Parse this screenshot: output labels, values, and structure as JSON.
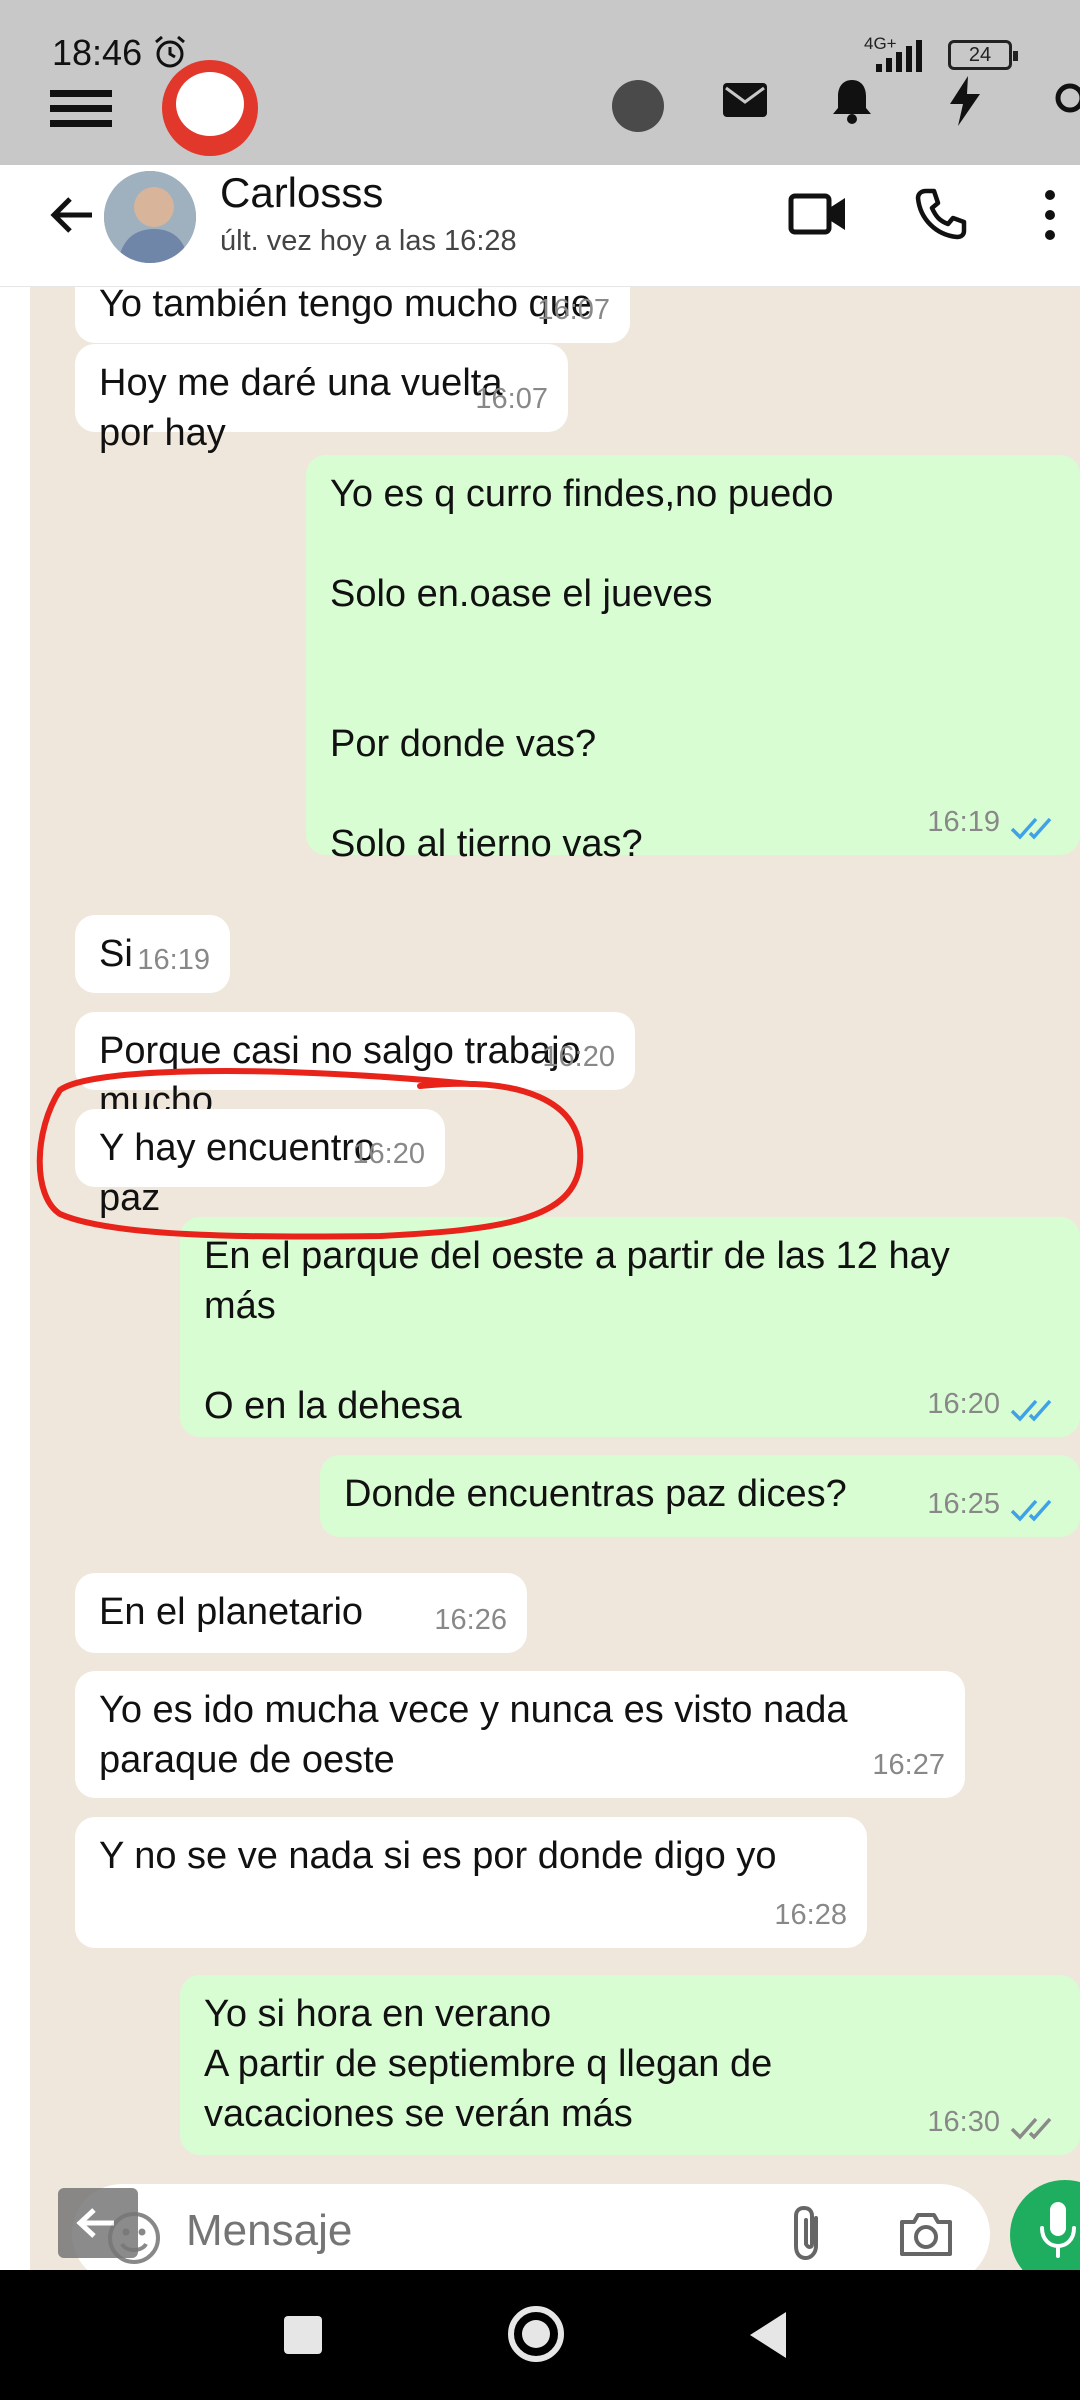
{
  "status_bar": {
    "time": "18:46",
    "network": "4G+",
    "battery": "24"
  },
  "chat_header": {
    "contact_name": "Carlosss",
    "last_seen": "últ. vez hoy a las 16:28"
  },
  "messages": [
    {
      "text": "Yo también tengo mucho que no voy",
      "time": "16:07"
    },
    {
      "text": "Hoy me daré una vuelta por hay",
      "time": "16:07"
    },
    {
      "text": "Yo es q curro findes,no puedo\n\nSolo en.oase el jueves\n\n\nPor donde vas?\n\nSolo al tierno vas?",
      "time": "16:19"
    },
    {
      "text": "Si",
      "time": "16:19"
    },
    {
      "text": "Porque casi no salgo trabajo mucho",
      "time": "16:20"
    },
    {
      "text": "Y hay encuentro paz",
      "time": "16:20"
    },
    {
      "text": "En el parque del oeste a partir de las 12 hay\nmás\n\nO en la dehesa",
      "time": "16:20"
    },
    {
      "text": "Donde encuentras paz dices?",
      "time": "16:25"
    },
    {
      "text": "En el planetario",
      "time": "16:26"
    },
    {
      "text": "Yo es ido mucha vece y nunca es visto nada\nparaque de oeste",
      "time": "16:27"
    },
    {
      "text": "Y no se ve nada si es por donde digo yo",
      "time": "16:28"
    },
    {
      "text": "Yo si hora en verano\nA partir de septiembre q llegan de\nvacaciones se verán más",
      "time": "16:30"
    }
  ],
  "input": {
    "placeholder": "Mensaje"
  },
  "colors": {
    "outgoing_bubble": "#d9fdd3",
    "incoming_bubble": "#ffffff",
    "chat_background": "#efe7dc",
    "read_ticks": "#3fa2e8",
    "annotation": "#e8231a",
    "mic_button": "#1fae5f"
  }
}
